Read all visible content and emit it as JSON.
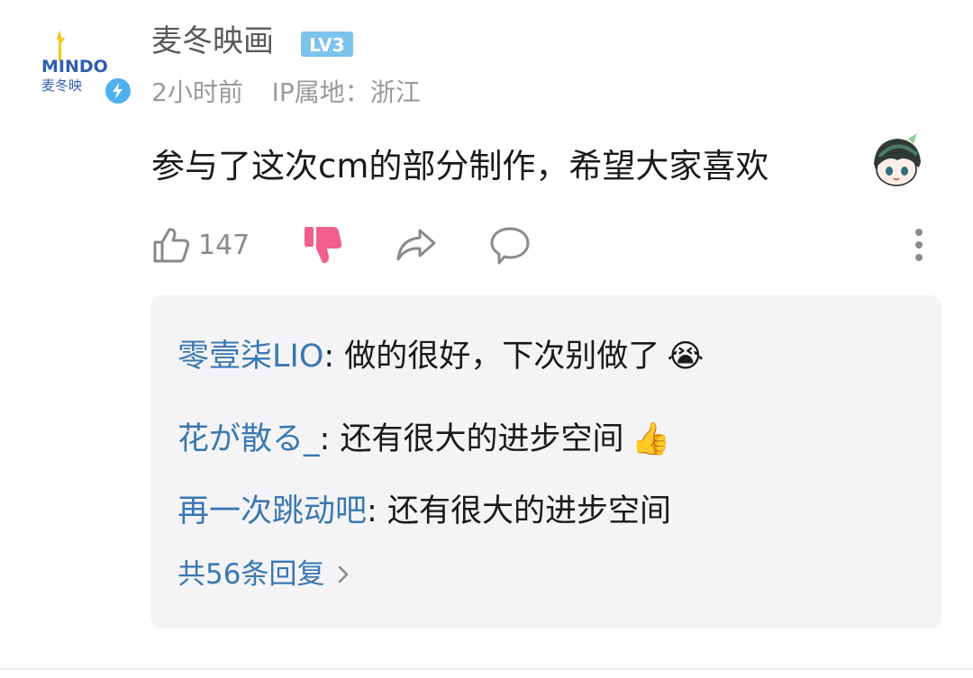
{
  "comment": {
    "username": "麦冬映画",
    "level": "LV3",
    "avatar": {
      "logo_text": "MINDO",
      "logo_subtext": "麦冬映"
    },
    "time": "2小时前",
    "ip_location": "IP属地：浙江",
    "text": "参与了这次cm的部分制作，希望大家喜欢",
    "like_count": "147",
    "icons": {
      "like": "thumbs-up-icon",
      "dislike": "thumbs-down-icon",
      "share": "share-icon",
      "reply": "reply-icon",
      "more": "more-vertical-icon"
    }
  },
  "replies": {
    "items": [
      {
        "author": "零壹柒LIO",
        "sep": ": ",
        "text": "做的很好，下次别做了",
        "emoji": "😭"
      },
      {
        "author": "花が散る_",
        "sep": ": ",
        "text": "还有很大的进步空间",
        "emoji": "👍"
      },
      {
        "author": "再一次跳动吧",
        "sep": ": ",
        "text": "还有很大的进步空间",
        "emoji": ""
      }
    ],
    "more_label": "共56条回复"
  },
  "colors": {
    "link": "#3a78b0",
    "dislike_active": "#f0608a",
    "level_badge": "#7cc3ee",
    "reply_bg": "#f4f4f6"
  }
}
